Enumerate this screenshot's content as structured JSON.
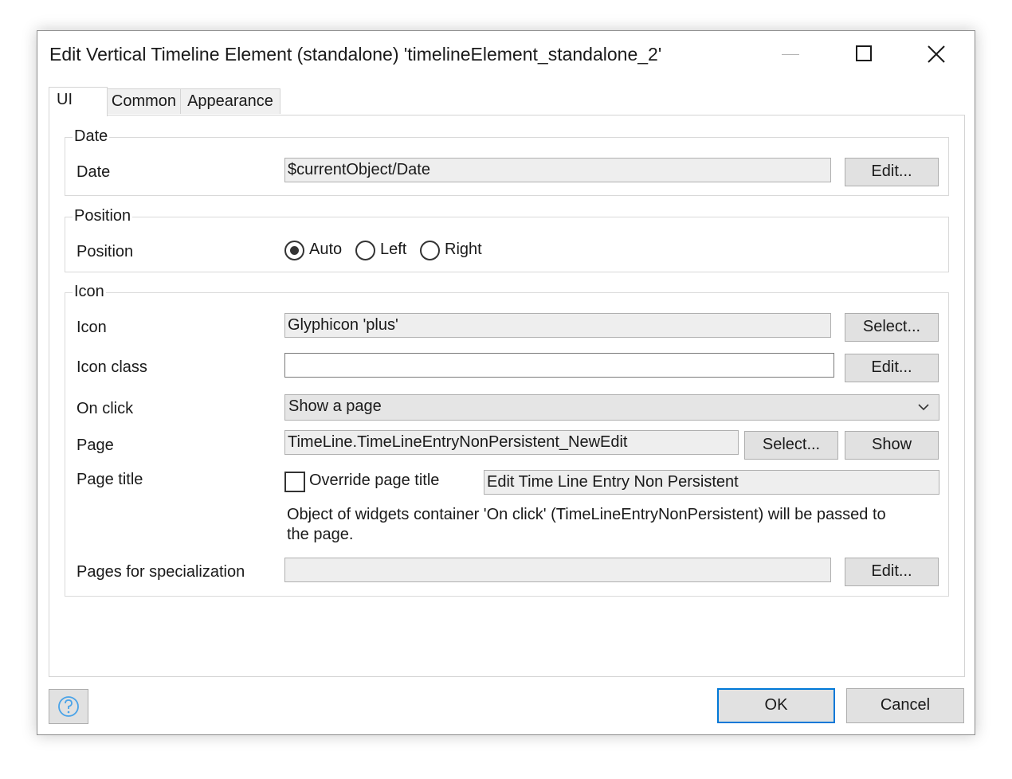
{
  "window": {
    "title": "Edit Vertical Timeline Element (standalone) 'timelineElement_standalone_2'"
  },
  "tabs": [
    {
      "label": "UI"
    },
    {
      "label": "Common"
    },
    {
      "label": "Appearance"
    }
  ],
  "date_group": {
    "legend": "Date",
    "date_label": "Date",
    "date_value": "$currentObject/Date",
    "edit_label": "Edit..."
  },
  "position_group": {
    "legend": "Position",
    "position_label": "Position",
    "options": [
      {
        "label": "Auto",
        "selected": true
      },
      {
        "label": "Left",
        "selected": false
      },
      {
        "label": "Right",
        "selected": false
      }
    ]
  },
  "icon_group": {
    "legend": "Icon",
    "icon_label": "Icon",
    "icon_value": "Glyphicon 'plus'",
    "icon_select_label": "Select...",
    "icon_class_label": "Icon class",
    "icon_class_value": "",
    "icon_class_edit_label": "Edit...",
    "on_click_label": "On click",
    "on_click_value": "Show a page",
    "page_label": "Page",
    "page_value": "TimeLine.TimeLineEntryNonPersistent_NewEdit",
    "page_select_label": "Select...",
    "page_show_label": "Show",
    "page_title_label": "Page title",
    "override_label": "Override page title",
    "override_checked": false,
    "page_title_value": "Edit Time Line Entry Non Persistent",
    "hint_line1": "Object of widgets container 'On click' (TimeLineEntryNonPersistent) will be passed to",
    "hint_line2": "the page.",
    "specialization_label": "Pages for specialization",
    "specialization_value": "",
    "specialization_edit_label": "Edit..."
  },
  "footer": {
    "ok_label": "OK",
    "cancel_label": "Cancel"
  },
  "colors": {
    "accent": "#0078d7",
    "help_icon": "#4aa3e8"
  }
}
